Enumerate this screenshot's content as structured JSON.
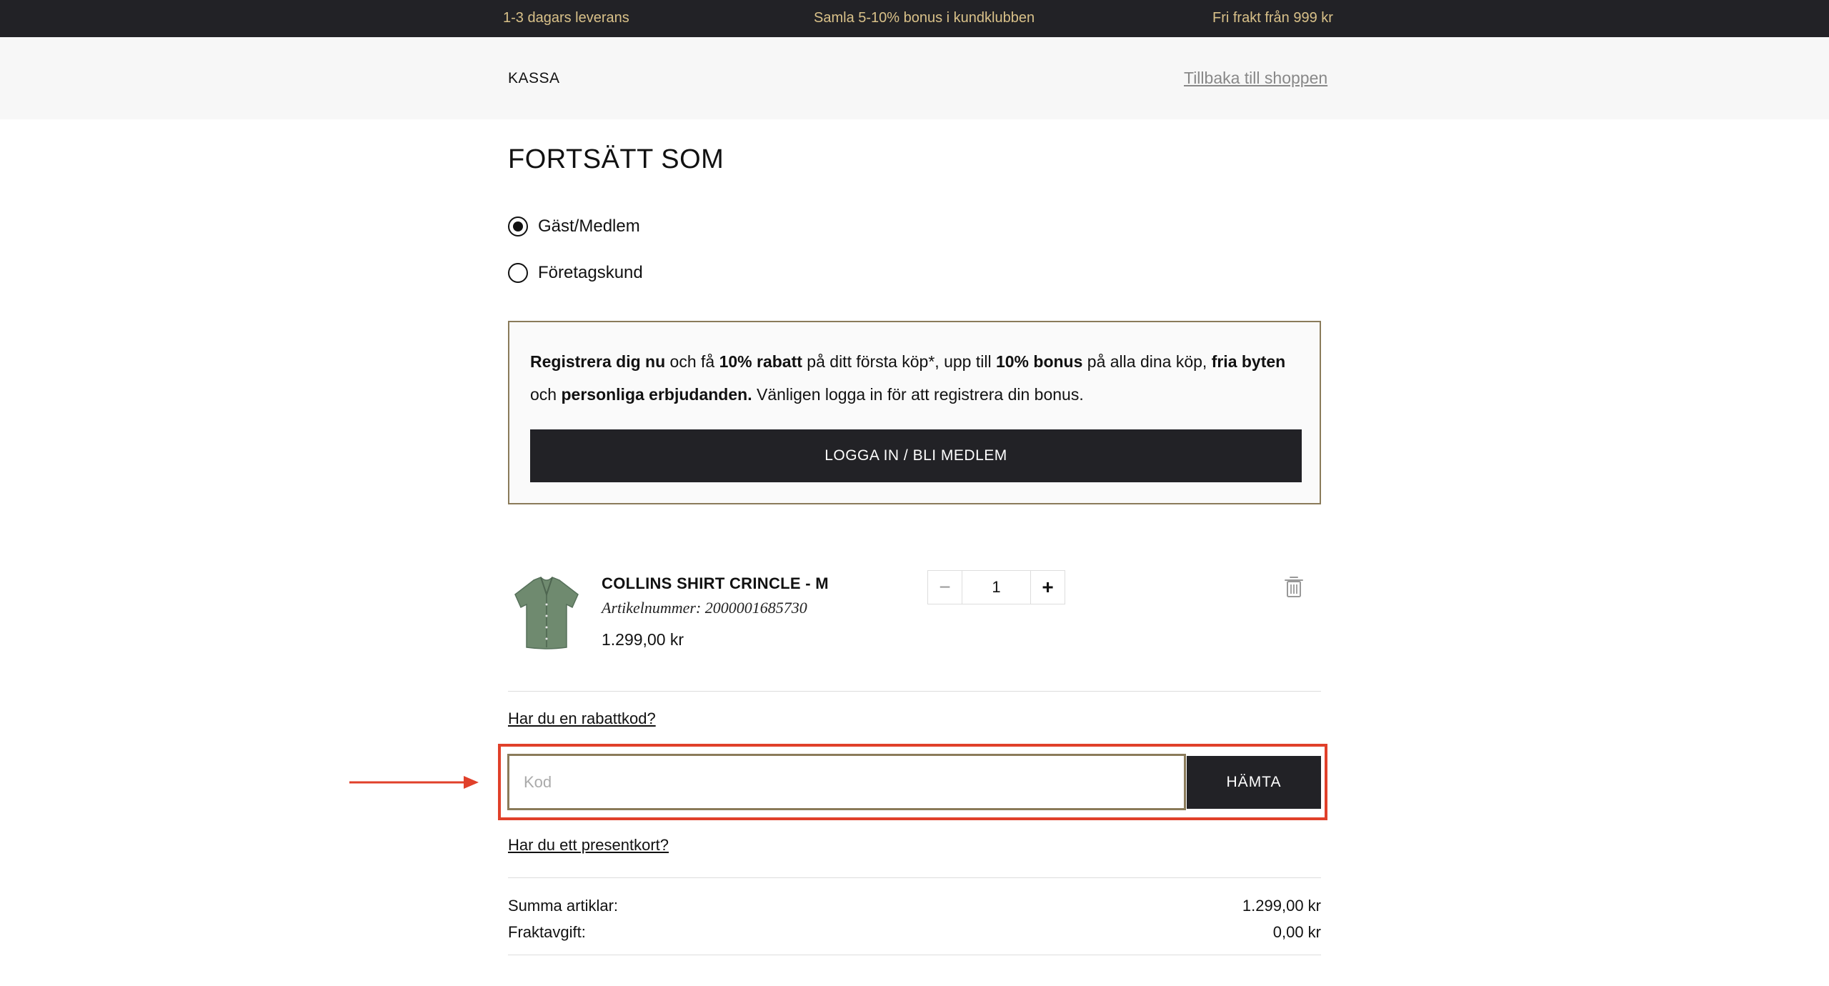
{
  "topbar": {
    "item1": "1-3 dagars leverans",
    "item2": "Samla 5-10% bonus i kundklubben",
    "item3": "Fri frakt från 999 kr"
  },
  "header": {
    "title": "KASSA",
    "back_link": "Tillbaka till shoppen"
  },
  "continue_as": {
    "title": "FORTSÄTT SOM",
    "options": [
      {
        "label": "Gäst/Medlem",
        "selected": true
      },
      {
        "label": "Företagskund",
        "selected": false
      }
    ]
  },
  "promo": {
    "bold1": "Registrera dig nu",
    "text1": " och få ",
    "bold2": "10% rabatt",
    "text2": " på ditt första köp*, upp till ",
    "bold3": "10% bonus",
    "text3": " på alla dina köp, ",
    "bold4": "fria byten",
    "text4": " och ",
    "bold5": "personliga erbjudanden.",
    "text5": " Vänligen logga in för att registrera din bonus.",
    "button_label": "LOGGA IN / BLI MEDLEM"
  },
  "cart": {
    "items": [
      {
        "name": "COLLINS SHIRT CRINCLE - M",
        "sku": "Artikelnummer: 2000001685730",
        "price": "1.299,00 kr",
        "quantity": "1",
        "minus": "−",
        "plus": "+"
      }
    ]
  },
  "discount": {
    "link": "Har du en rabattkod?",
    "placeholder": "Kod",
    "button_label": "HÄMTA"
  },
  "giftcard": {
    "link": "Har du ett presentkort?"
  },
  "summary": {
    "items_label": "Summa artiklar:",
    "items_value": "1.299,00 kr",
    "shipping_label": "Fraktavgift:",
    "shipping_value": "0,00 kr"
  },
  "colors": {
    "topbar_bg": "#222226",
    "topbar_text": "#d9c189",
    "accent_border": "#8a7b5a",
    "highlight": "#e0402a",
    "shirt": "#6f8a6f"
  }
}
